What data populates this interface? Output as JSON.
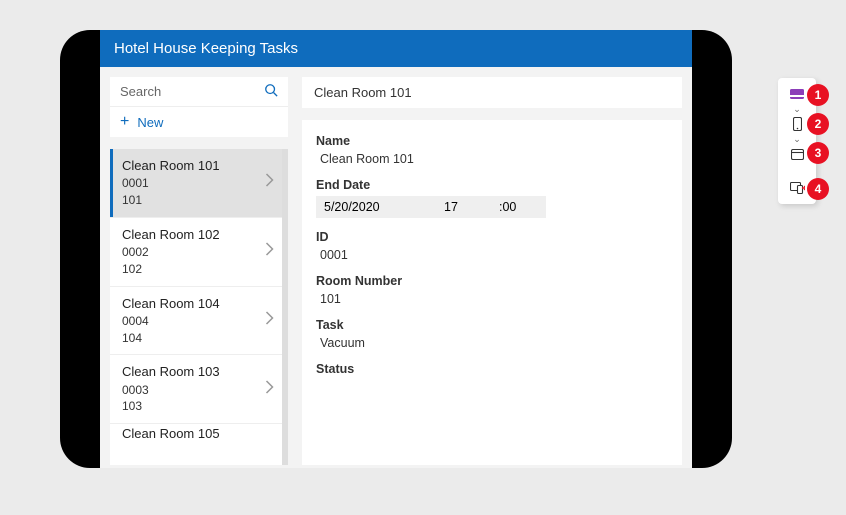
{
  "app_title": "Hotel House Keeping Tasks",
  "search": {
    "placeholder": "Search"
  },
  "new_label": "New",
  "tasks": [
    {
      "title": "Clean Room 101",
      "id": "0001",
      "room": "101",
      "selected": true
    },
    {
      "title": "Clean Room 102",
      "id": "0002",
      "room": "102",
      "selected": false
    },
    {
      "title": "Clean Room 104",
      "id": "0004",
      "room": "104",
      "selected": false
    },
    {
      "title": "Clean Room 103",
      "id": "0003",
      "room": "103",
      "selected": false
    }
  ],
  "partial_next_title": "Clean Room 105",
  "detail": {
    "header": "Clean Room 101",
    "name_label": "Name",
    "name_value": "Clean Room 101",
    "end_date_label": "End Date",
    "end_date_date": "5/20/2020",
    "end_date_hour": "17",
    "end_date_min": ":00",
    "id_label": "ID",
    "id_value": "0001",
    "room_label": "Room Number",
    "room_value": "101",
    "task_label": "Task",
    "task_value": "Vacuum",
    "status_label": "Status"
  },
  "callouts": [
    "1",
    "2",
    "3",
    "4"
  ]
}
